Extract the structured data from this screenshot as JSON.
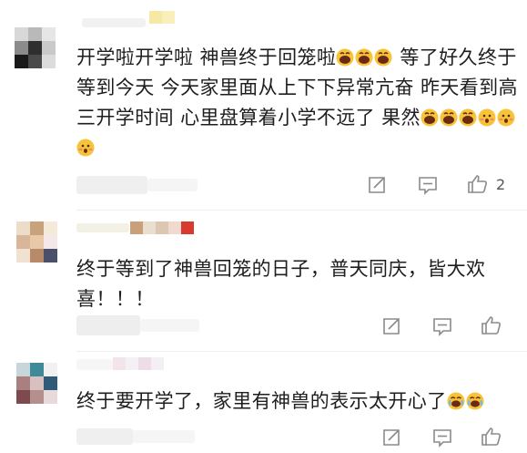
{
  "comments": [
    {
      "text": "开学啦开学啦 神兽终于回笼啦",
      "text_after_emoji": " 等了好久终于等到今天 今天家里面从上下下异常亢奋 昨天看到高三开学时间 心里盘算着小学不远了 果然",
      "emoji_inline": [
        "laughing-emoji",
        "laughing-emoji",
        "laughing-emoji"
      ],
      "emoji_end": [
        "laughing-emoji",
        "laughing-emoji",
        "laughing-emoji",
        "blushing-emoji",
        "blushing-emoji",
        "blushing-emoji"
      ],
      "likes": "2"
    },
    {
      "text": "终于等到了神兽回笼的日子，普天同庆，皆大欢喜！！！"
    },
    {
      "text": "终于要开学了，家里有神兽的表示太开心了",
      "emoji_end": [
        "crying-laughing-emoji",
        "crying-laughing-emoji"
      ]
    }
  ],
  "icons": [
    "share-icon",
    "comment-icon",
    "thumbs-up-icon"
  ],
  "colors": {
    "text": "#1e1e1e",
    "icon": "#8a8a8a"
  }
}
